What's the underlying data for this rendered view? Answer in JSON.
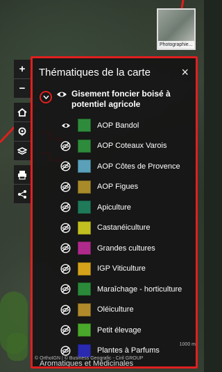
{
  "panel": {
    "title": "Thématiques de la carte",
    "close_glyph": "×",
    "group": {
      "title": "Gisement foncier boisé à potentiel agricole",
      "expand_icon": "chevron-down-icon",
      "visibility_icon": "eye-icon"
    },
    "items": [
      {
        "label": "AOP Bandol",
        "color": "#2e8b3c",
        "visible": true
      },
      {
        "label": "AOP Coteaux Varois",
        "color": "#2e8b3c",
        "visible": false
      },
      {
        "label": "AOP Côtes de Provence",
        "color": "#5aa0b8",
        "visible": false
      },
      {
        "label": "AOP Figues",
        "color": "#a88a2a",
        "visible": false
      },
      {
        "label": "Apiculture",
        "color": "#1f7a5a",
        "visible": false
      },
      {
        "label": "Castanéiculture",
        "color": "#c2c020",
        "visible": false
      },
      {
        "label": "Grandes cultures",
        "color": "#b02a8c",
        "visible": false
      },
      {
        "label": "IGP Viticulture",
        "color": "#d4a31a",
        "visible": false
      },
      {
        "label": "Maraîchage - horticulture",
        "color": "#2a8a3a",
        "visible": false
      },
      {
        "label": "Oléiculture",
        "color": "#b08a2a",
        "visible": false
      },
      {
        "label": "Petit élevage",
        "color": "#4aa82a",
        "visible": false
      },
      {
        "label": "Plantes à Parfums",
        "color": "#2a2ab0",
        "visible": false
      }
    ],
    "trailing_text": "Aromatiques et Médicinales"
  },
  "photo": {
    "caption": "Photographie..."
  },
  "toolbar": {
    "zoom_in": "+",
    "zoom_out": "−",
    "icons": [
      "home-icon",
      "location-pin-icon",
      "layers-icon",
      "print-icon",
      "share-icon"
    ]
  },
  "map": {
    "attribution": "© OrthoIGN | © Business Geografic - Ciril GROUP",
    "scale": "1000 m"
  },
  "colors": {
    "highlight": "#e01f1f",
    "panel_bg": "#141414"
  }
}
